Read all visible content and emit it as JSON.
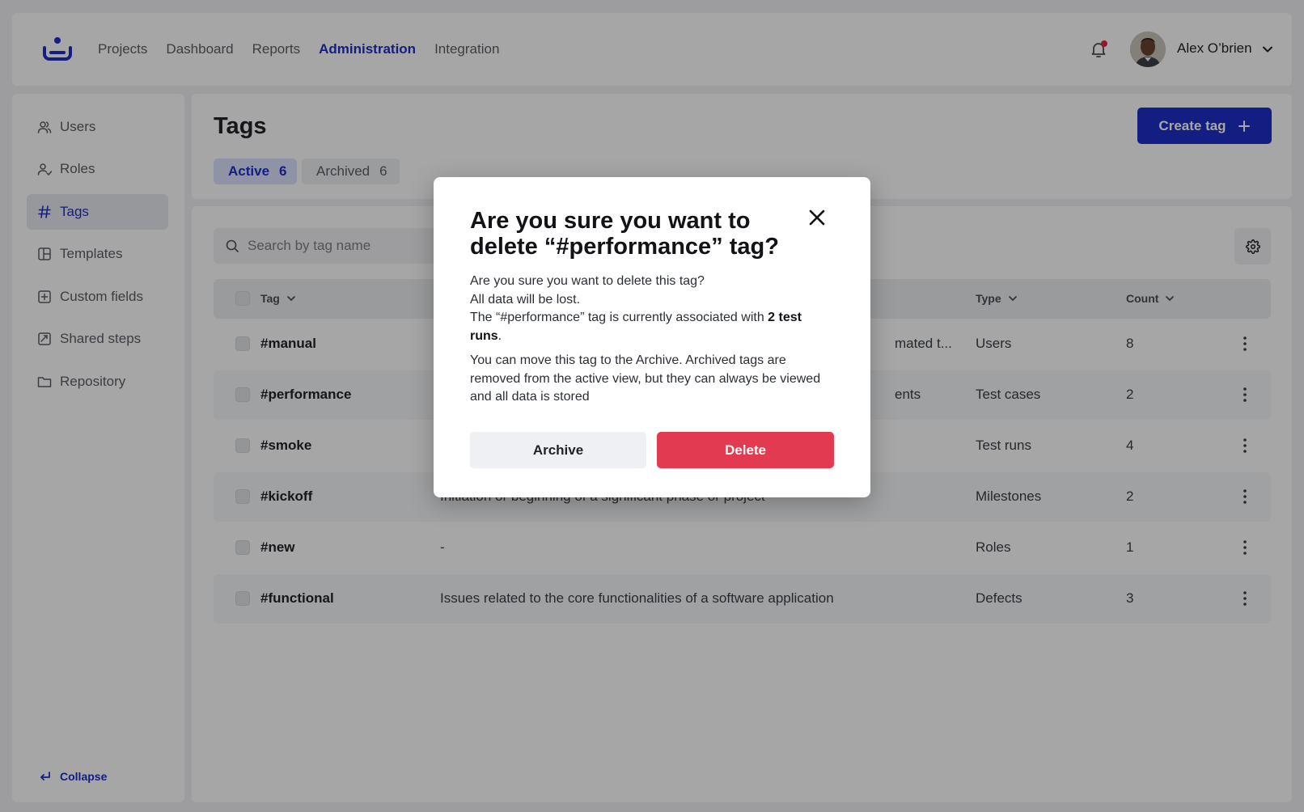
{
  "nav": {
    "links": [
      "Projects",
      "Dashboard",
      "Reports",
      "Administration",
      "Integration"
    ],
    "active": "Administration",
    "user_name": "Alex O’brien"
  },
  "sidebar": {
    "items": [
      {
        "label": "Users",
        "icon": "users-icon"
      },
      {
        "label": "Roles",
        "icon": "roles-icon"
      },
      {
        "label": "Tags",
        "icon": "hash-icon"
      },
      {
        "label": "Templates",
        "icon": "template-icon"
      },
      {
        "label": "Custom fields",
        "icon": "plus-square-icon"
      },
      {
        "label": "Shared steps",
        "icon": "shared-steps-icon"
      },
      {
        "label": "Repository",
        "icon": "folder-icon"
      }
    ],
    "active": "Tags",
    "collapse_label": "Collapse"
  },
  "page": {
    "title": "Tags",
    "create_label": "Create tag",
    "tabs": [
      {
        "label": "Active",
        "count": "6"
      },
      {
        "label": "Archived",
        "count": "6"
      }
    ]
  },
  "table": {
    "search_placeholder": "Search by tag name",
    "columns": {
      "tag": "Tag",
      "type": "Type",
      "count": "Count"
    },
    "rows": [
      {
        "tag": "#manual",
        "desc": "mated t...",
        "type": "Users",
        "count": "8"
      },
      {
        "tag": "#performance",
        "desc": "ents",
        "type": "Test cases",
        "count": "2"
      },
      {
        "tag": "#smoke",
        "desc": "",
        "type": "Test runs",
        "count": "4"
      },
      {
        "tag": "#kickoff",
        "desc": "Initiation or beginning of a significant phase or project",
        "type": "Milestones",
        "count": "2"
      },
      {
        "tag": "#new",
        "desc": "-",
        "type": "Roles",
        "count": "1"
      },
      {
        "tag": "#functional",
        "desc": "Issues related to the core functionalities of a software application",
        "type": "Defects",
        "count": "3"
      }
    ]
  },
  "modal": {
    "title": "Are you sure you want to delete “#performance” tag?",
    "line1": "Are you sure you want to delete this tag?",
    "line2": "All data will be lost.",
    "assoc_prefix": "The “#performance” tag is currently associated with ",
    "assoc_bold": "2 test runs",
    "assoc_suffix": ".",
    "archive_text": "You can move this tag to the Archive. Archived tags are removed from the active view, but they can always be viewed and all data is stored",
    "archive_label": "Archive",
    "delete_label": "Delete"
  },
  "colors": {
    "accent": "#1d2ec6",
    "danger": "#e23a50",
    "notification_dot": "#e5263f"
  }
}
